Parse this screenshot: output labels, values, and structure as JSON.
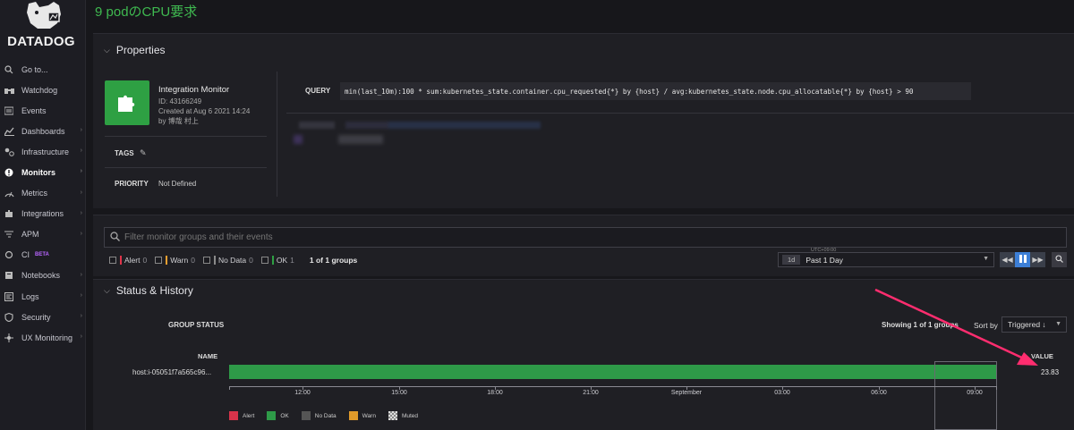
{
  "brand": {
    "name": "DATADOG"
  },
  "nav": [
    {
      "label": "Go to...",
      "icon": "search-icon"
    },
    {
      "label": "Watchdog",
      "icon": "binoculars-icon"
    },
    {
      "label": "Events",
      "icon": "events-icon"
    },
    {
      "label": "Dashboards",
      "icon": "dashboards-icon",
      "caret": "›"
    },
    {
      "label": "Infrastructure",
      "icon": "infrastructure-icon",
      "caret": "›"
    },
    {
      "label": "Monitors",
      "icon": "monitors-icon",
      "caret": "›"
    },
    {
      "label": "Metrics",
      "icon": "metrics-icon",
      "caret": "›"
    },
    {
      "label": "Integrations",
      "icon": "integrations-icon",
      "caret": "›"
    },
    {
      "label": "APM",
      "icon": "apm-icon",
      "caret": "›"
    },
    {
      "label": "CI",
      "icon": "ci-icon",
      "badge": "BETA"
    },
    {
      "label": "Notebooks",
      "icon": "notebooks-icon",
      "caret": "›"
    },
    {
      "label": "Logs",
      "icon": "logs-icon",
      "caret": "›"
    },
    {
      "label": "Security",
      "icon": "security-icon",
      "caret": "›"
    },
    {
      "label": "UX Monitoring",
      "icon": "ux-monitoring-icon",
      "caret": "›"
    }
  ],
  "page": {
    "title": "9 podのCPU要求"
  },
  "properties": {
    "heading": "Properties",
    "monitor_type": "Integration Monitor",
    "id": "ID: 43166249",
    "created": "Created at Aug 6 2021 14:24",
    "by": "by 博哉 村上",
    "tags_label": "TAGS",
    "priority_label": "PRIORITY",
    "priority_value": "Not Defined",
    "query_label": "QUERY",
    "query": "min(last_10m):100 * sum:kubernetes_state.container.cpu_requested{*} by {host} / avg:kubernetes_state.node.cpu_allocatable{*} by {host} > 90"
  },
  "filter": {
    "placeholder": "Filter monitor groups and their events",
    "checks": [
      {
        "label": "Alert",
        "count": "0",
        "color": "#e0344a"
      },
      {
        "label": "Warn",
        "count": "0",
        "color": "#f0a030"
      },
      {
        "label": "No Data",
        "count": "0",
        "color": "#8a8a8a"
      },
      {
        "label": "OK",
        "count": "1",
        "color": "#2ea043"
      }
    ],
    "groups": "1 of 1 groups",
    "timezone": "UTC+09:00",
    "time_badge": "1d",
    "time_range": "Past 1 Day"
  },
  "status": {
    "heading": "Status & History",
    "group_status": "GROUP STATUS",
    "showing": "Showing 1 of 1 groups",
    "sort_label": "Sort by",
    "sort_value": "Triggered ↓",
    "name_header": "NAME",
    "value_header": "VALUE",
    "host": "host:i-05051f7a565c96...",
    "value": "23.83",
    "state": "OK",
    "axis_ticks": [
      "12:00",
      "15:00",
      "18:00",
      "21:00",
      "September",
      "03:00",
      "06:00",
      "09:00"
    ],
    "legend": [
      {
        "label": "Alert",
        "color": "#d8334a"
      },
      {
        "label": "OK",
        "color": "#2e9a48"
      },
      {
        "label": "No Data",
        "color": "#555555"
      },
      {
        "label": "Warn",
        "color": "#e09a2a"
      },
      {
        "label": "Muted",
        "color": "checker"
      }
    ]
  },
  "colors": {
    "ok": "#2ea043",
    "annotation_arrow": "#ff2d6f",
    "accent_blue": "#3d7fd6"
  }
}
